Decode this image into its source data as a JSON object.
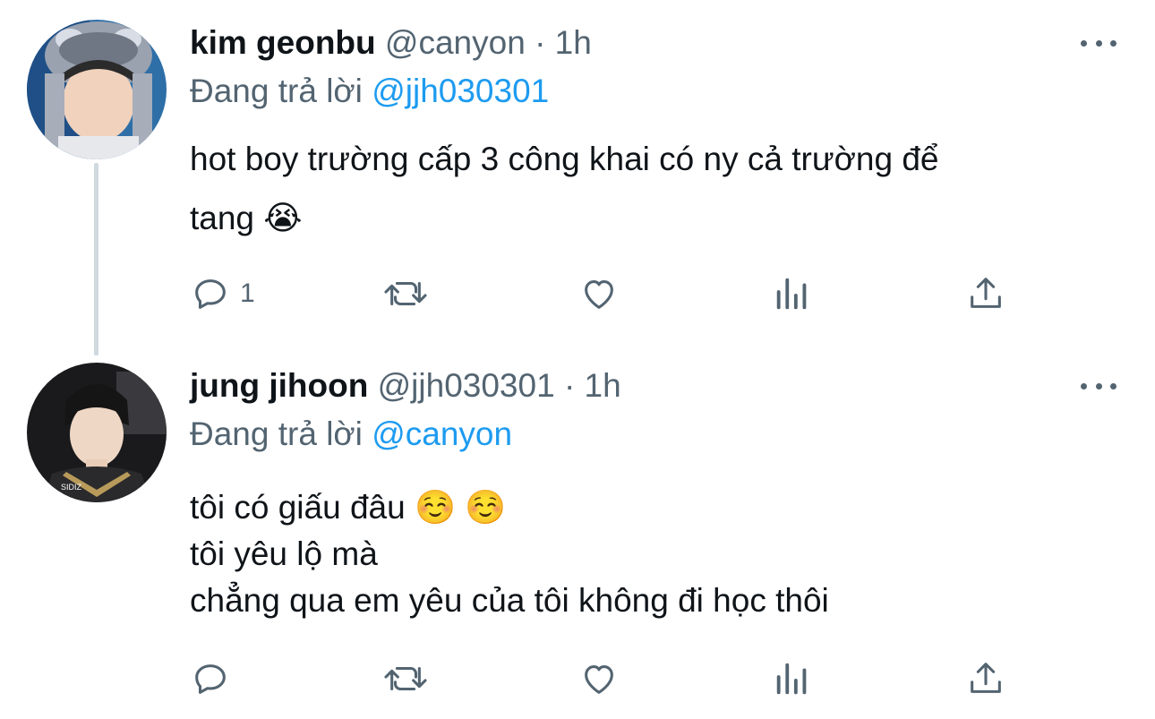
{
  "tweets": [
    {
      "name": "kim geonbu",
      "handle": "@canyon",
      "separator": "·",
      "time": "1h",
      "reply_prefix": "Đang trả lời",
      "reply_to": "@jjh030301",
      "text_lines": [
        "hot boy trường cấp 3 công khai có ny cả trường để",
        "tang 😭"
      ],
      "reply_count": "1",
      "avatar_icon": "avatar-kim-geonbu"
    },
    {
      "name": "jung jihoon",
      "handle": "@jjh030301",
      "separator": "·",
      "time": "1h",
      "reply_prefix": "Đang trả lời",
      "reply_to": "@canyon",
      "text_lines": [
        "tôi có giấu đâu ☺️ ☺️",
        "tôi yêu lộ mà",
        "chẳng qua em yêu của tôi không đi học thôi"
      ],
      "reply_count": "",
      "avatar_icon": "avatar-jung-jihoon"
    }
  ],
  "icons": {
    "reply": "reply-icon",
    "retweet": "retweet-icon",
    "like": "heart-icon",
    "stats": "analytics-icon",
    "share": "share-icon",
    "more": "more-icon"
  },
  "colors": {
    "accent": "#1d9bf0",
    "secondary_text": "#536471",
    "thread_line": "#cfd9de"
  }
}
